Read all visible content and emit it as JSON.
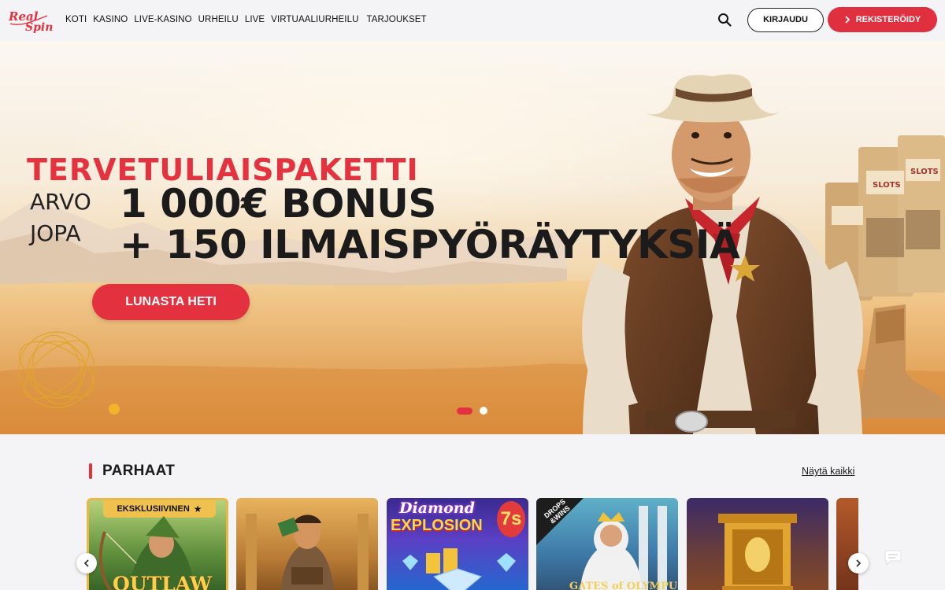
{
  "brand": {
    "logo_text": "RealSpin"
  },
  "nav": [
    "KOTI",
    "KASINO",
    "LIVE-KASINO",
    "URHEILU",
    "LIVE",
    "VIRTUAALIURHEILU",
    "TARJOUKSET"
  ],
  "header": {
    "login_label": "KIRJAUDU",
    "register_label": "REKISTERÖIDY"
  },
  "hero": {
    "kicker": "TERVETULIAISPAKETTI",
    "pre_line1": "ARVO",
    "pre_line2": "JOPA",
    "headline1": "1 000€ BONUS",
    "headline2": "+ 150 ILMAISPYÖRÄYTYKSIÄ",
    "cta_label": "LUNASTA HETI",
    "slides_total": 2,
    "slide_active": 1
  },
  "section": {
    "title": "PARHAAT",
    "show_all": "Näytä kaikki"
  },
  "games": [
    {
      "badge": "EKSKLUSIIVINEN",
      "title": "OUTLAW"
    },
    {
      "title": ""
    },
    {
      "title": "Diamond Explosion 7s",
      "line1": "Diamond",
      "line2": "EXPLOSION"
    },
    {
      "badge": "DROPS & WINS",
      "badge_line1": "DROPS",
      "badge_line2": "&WINS",
      "title": "GATES of OLYMPUS"
    },
    {
      "title": ""
    },
    {
      "title": ""
    }
  ],
  "colors": {
    "accent": "#e3313f",
    "page_bg": "#f4f4f6"
  }
}
